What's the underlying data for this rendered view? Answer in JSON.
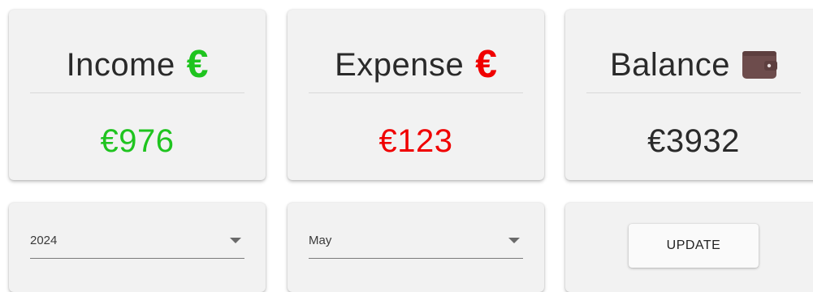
{
  "stats": {
    "income": {
      "label": "Income",
      "amount": "€976",
      "icon": "euro-icon",
      "color": "#1fc41f"
    },
    "expense": {
      "label": "Expense",
      "amount": "€123",
      "icon": "euro-icon",
      "color": "#f00000"
    },
    "balance": {
      "label": "Balance",
      "amount": "€3932",
      "icon": "wallet-icon",
      "color": "#2a2a2a",
      "icon_color": "#6d4c4c"
    }
  },
  "filters": {
    "year": {
      "value": "2024"
    },
    "month": {
      "value": "May"
    }
  },
  "actions": {
    "update_label": "UPDATE"
  }
}
